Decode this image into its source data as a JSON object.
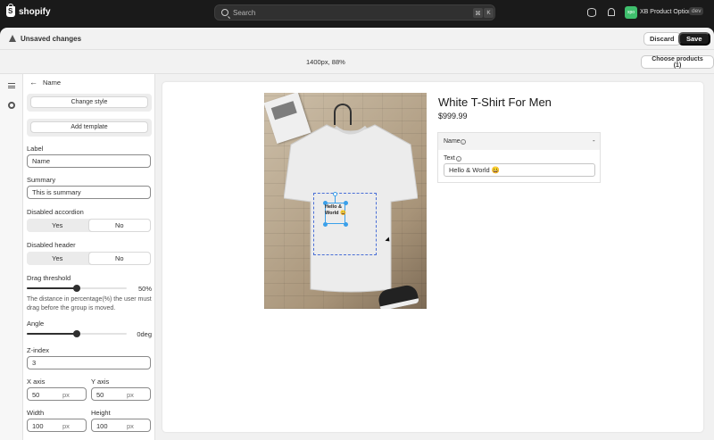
{
  "topbar": {
    "brand": "shopify",
    "search_placeholder": "Search",
    "shortcut_keys": [
      "⌘",
      "K"
    ],
    "app_badge": "xpo",
    "store_name": "XB Product Options",
    "env_badge": "dev"
  },
  "save_bar": {
    "message": "Unsaved changes",
    "discard_label": "Discard",
    "save_label": "Save"
  },
  "preview_header": {
    "viewport": "1400px, 88%",
    "choose_products_label": "Choose products (1)"
  },
  "panel": {
    "title": "Name",
    "change_style_label": "Change style",
    "add_template_label": "Add template",
    "label_field": {
      "label": "Label",
      "value": "Name"
    },
    "summary_field": {
      "label": "Summary",
      "value": "This is summary"
    },
    "disabled_accordion": {
      "label": "Disabled accordion",
      "yes": "Yes",
      "no": "No",
      "selected": "Yes"
    },
    "disabled_header": {
      "label": "Disabled header",
      "yes": "Yes",
      "no": "No",
      "selected": "Yes"
    },
    "drag_threshold": {
      "label": "Drag threshold",
      "value_text": "50%",
      "value": 50,
      "max": 100,
      "help": "The distance in percentage(%) the user must drag before the group is moved."
    },
    "angle": {
      "label": "Angle",
      "value_text": "0deg",
      "fraction": 0.5
    },
    "z_index": {
      "label": "Z-index",
      "value": "3"
    },
    "x_axis": {
      "label": "X axis",
      "value": "50",
      "unit": "px"
    },
    "y_axis": {
      "label": "Y axis",
      "value": "50",
      "unit": "px"
    },
    "width": {
      "label": "Width",
      "value": "100",
      "unit": "px"
    },
    "height": {
      "label": "Height",
      "value": "100",
      "unit": "px"
    }
  },
  "product": {
    "title": "White T-Shirt For Men",
    "price": "$999.99",
    "option_name": "Name",
    "collapse_symbol": "-",
    "text_label": "Text",
    "text_value": "Hello & World 😀",
    "artwork_text": "Hello & World 😀"
  },
  "colors": {
    "accent": "#1a1a1a",
    "selection": "#3aa0ea",
    "print_area": "#4a6fd6",
    "app_badge": "#3fbf6d"
  }
}
